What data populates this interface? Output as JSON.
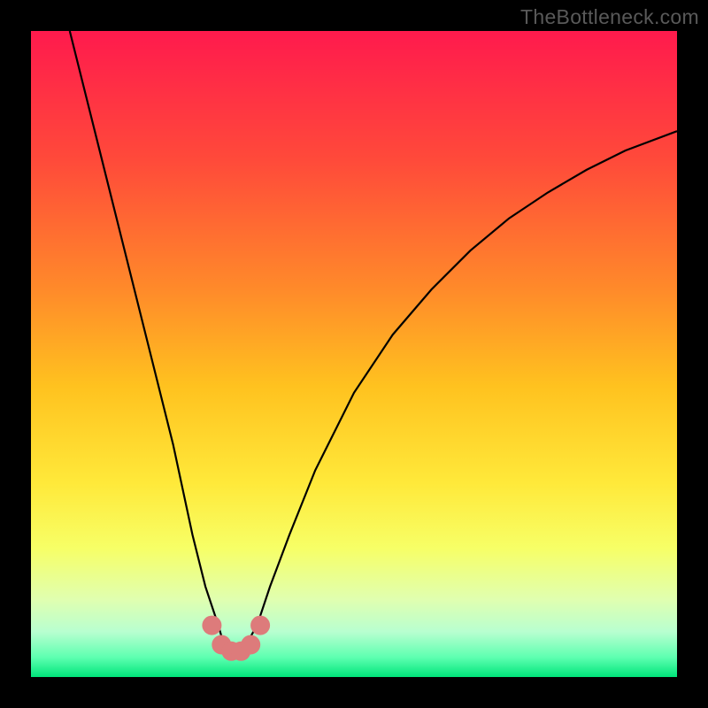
{
  "watermark": "TheBottleneck.com",
  "chart_data": {
    "type": "line",
    "title": "",
    "xlabel": "",
    "ylabel": "",
    "xlim": [
      0,
      100
    ],
    "ylim": [
      0,
      100
    ],
    "series": [
      {
        "name": "curve",
        "x": [
          6,
          10,
          14,
          18,
          22,
          25,
          27,
          29,
          30,
          31.5,
          33,
          35,
          37,
          40,
          44,
          50,
          56,
          62,
          68,
          74,
          80,
          86,
          92,
          100
        ],
        "y": [
          100,
          84,
          68,
          52,
          36,
          22,
          14,
          8,
          4.5,
          3.8,
          4.5,
          8,
          14,
          22,
          32,
          44,
          53,
          60,
          66,
          71,
          75,
          78.5,
          81.5,
          84.5
        ]
      }
    ],
    "markers": {
      "name": "bottom-cluster",
      "color": "#dd7b7b",
      "points": [
        {
          "x": 28.0,
          "y": 8.0
        },
        {
          "x": 29.5,
          "y": 5.0
        },
        {
          "x": 31.0,
          "y": 4.0
        },
        {
          "x": 32.5,
          "y": 4.0
        },
        {
          "x": 34.0,
          "y": 5.0
        },
        {
          "x": 35.5,
          "y": 8.0
        }
      ]
    },
    "gradient_stops": [
      {
        "offset": 0.0,
        "color": "#ff1a4d"
      },
      {
        "offset": 0.2,
        "color": "#ff4a3a"
      },
      {
        "offset": 0.4,
        "color": "#ff8a2a"
      },
      {
        "offset": 0.55,
        "color": "#ffc21f"
      },
      {
        "offset": 0.7,
        "color": "#ffe93a"
      },
      {
        "offset": 0.8,
        "color": "#f7ff66"
      },
      {
        "offset": 0.88,
        "color": "#e0ffb0"
      },
      {
        "offset": 0.93,
        "color": "#b8ffd0"
      },
      {
        "offset": 0.97,
        "color": "#5dffb0"
      },
      {
        "offset": 1.0,
        "color": "#00e57a"
      }
    ]
  }
}
